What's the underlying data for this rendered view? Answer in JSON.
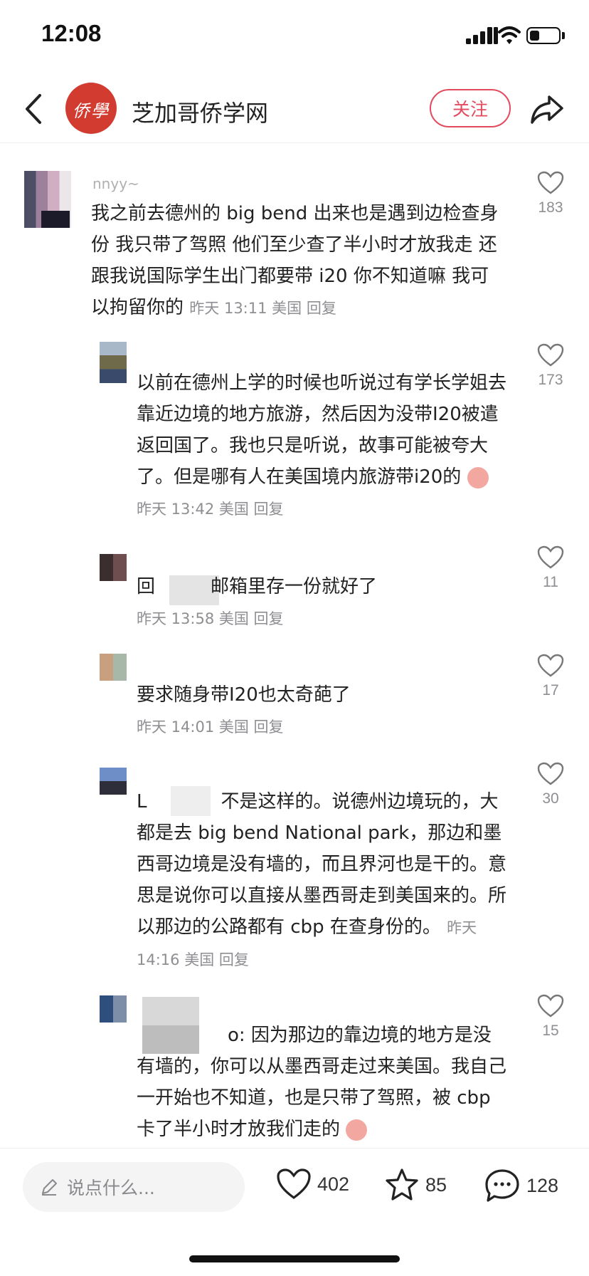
{
  "status_bar": {
    "time": "12:08"
  },
  "header": {
    "account_name": "芝加哥侨学网",
    "follow_label": "关注"
  },
  "comments": [
    {
      "username": "nnyy~",
      "text": "我之前去德州的 big bend 出来也是遇到边检查身份 我只带了驾照 他们至少查了半小时才放我走 还跟我说国际学生出门都要带 i20 你不知道嘛 我可以拘留你的",
      "meta": "昨天 13:11 美国 回复",
      "likes": "183"
    },
    {
      "username": "",
      "text": "以前在德州上学的时候也听说过有学长学姐去靠近边境的地方旅游，然后因为没带I20被遣返回国了。我也只是听说，故事可能被夸大了。但是哪有人在美国境内旅游带i20的",
      "meta": "昨天 13:42 美国 回复",
      "likes": "173"
    },
    {
      "username": "",
      "text": "回　　　邮箱里存一份就好了",
      "meta": "昨天 13:58 美国 回复",
      "likes": "11"
    },
    {
      "username": "",
      "text": "要求随身带I20也太奇葩了",
      "meta": "昨天 14:01 美国 回复",
      "likes": "17"
    },
    {
      "username": "",
      "text": "L　　　　不是这样的。说德州边境玩的，大都是去 big bend National park，那边和墨西哥边境是没有墙的，而且界河也是干的。意思是说你可以直接从墨西哥走到美国来的。所以那边的公路都有 cbp 在查身份的。",
      "meta": "昨天 14:16 美国 回复",
      "likes": "30"
    },
    {
      "username": "",
      "text": "o: 因为那边的靠边境的地方是没有墙的，你可以从墨西哥走过来美国。我自己一开始也不知道，也是只带了驾照，被 cbp 卡了半小时才放我们走的",
      "meta": "",
      "likes": "15"
    }
  ],
  "bottom_bar": {
    "input_placeholder": "说点什么...",
    "like_count": "402",
    "collect_count": "85",
    "comment_count": "128"
  }
}
